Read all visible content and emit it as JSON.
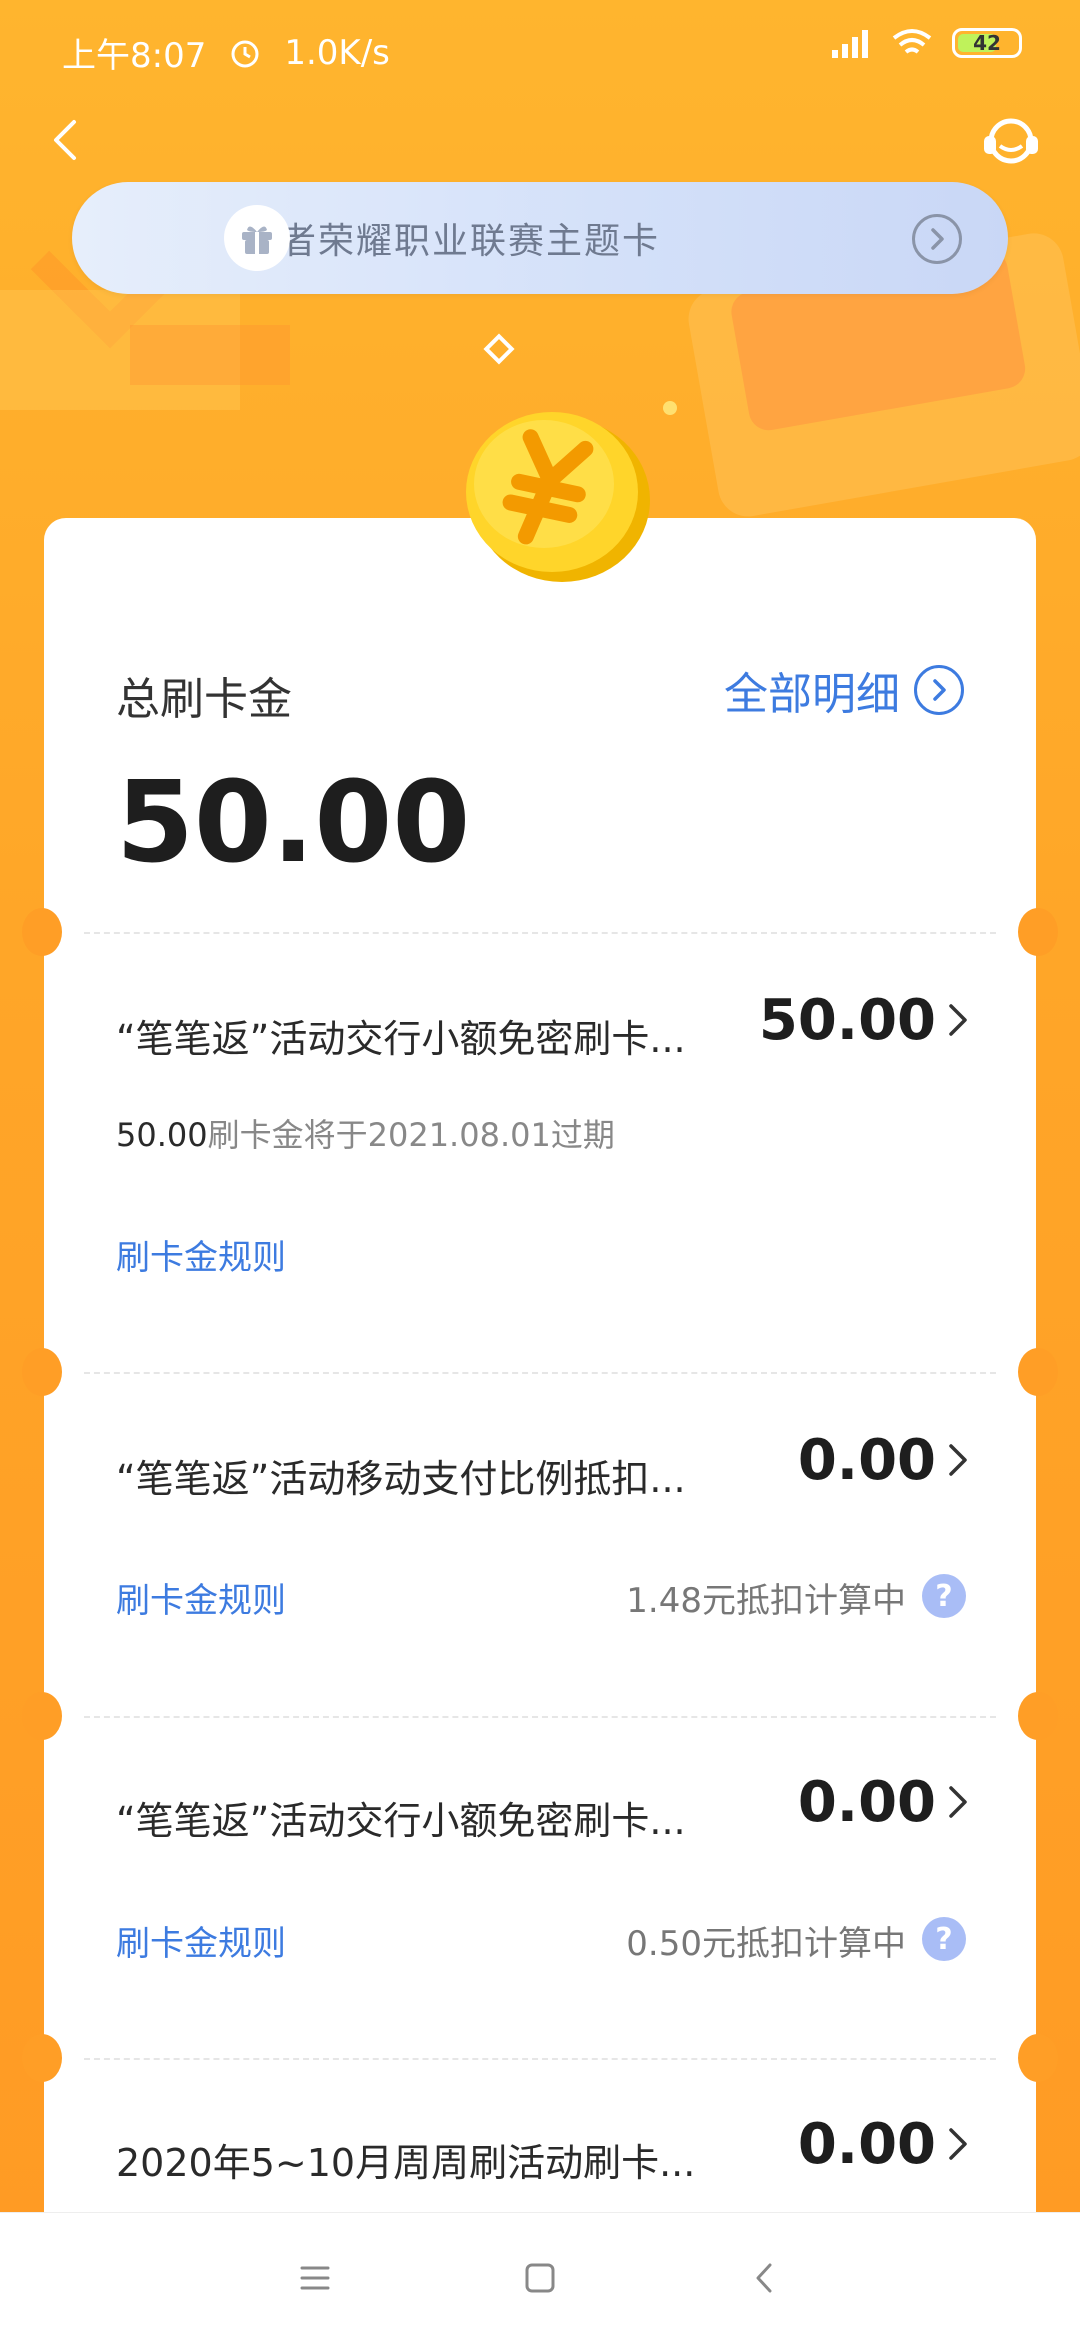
{
  "status_bar": {
    "time": "上午8:07",
    "net_speed": "1.0K/s",
    "battery": "42",
    "icons": [
      "alarm-icon",
      "signal-icon",
      "wifi-icon",
      "battery-icon"
    ]
  },
  "nav": {
    "back_icon": "chevron-left-icon",
    "service_icon": "customer-service-icon"
  },
  "promo": {
    "text": "王者荣耀职业联赛主题卡",
    "icon": "gift-icon"
  },
  "summary": {
    "label": "总刷卡金",
    "detail_link": "全部明细",
    "total": "50.00"
  },
  "items": [
    {
      "title": "“笔笔返”活动交行小额免密刷卡...",
      "amount": "50.00",
      "expire_amount": "50.00",
      "expire_text": "刷卡金将于2021.08.01过期",
      "rule": "刷卡金规则"
    },
    {
      "title": "“笔笔返”活动移动支付比例抵扣...",
      "amount": "0.00",
      "rule": "刷卡金规则",
      "calc": "1.48元抵扣计算中"
    },
    {
      "title": "“笔笔返”活动交行小额免密刷卡...",
      "amount": "0.00",
      "rule": "刷卡金规则",
      "calc": "0.50元抵扣计算中"
    },
    {
      "title": "2020年5~10月周周刷活动刷卡...",
      "amount": "0.00"
    }
  ],
  "colors": {
    "background": "#FFA628",
    "link_blue": "#3D7BE0",
    "banner": "#D3E0F9"
  }
}
